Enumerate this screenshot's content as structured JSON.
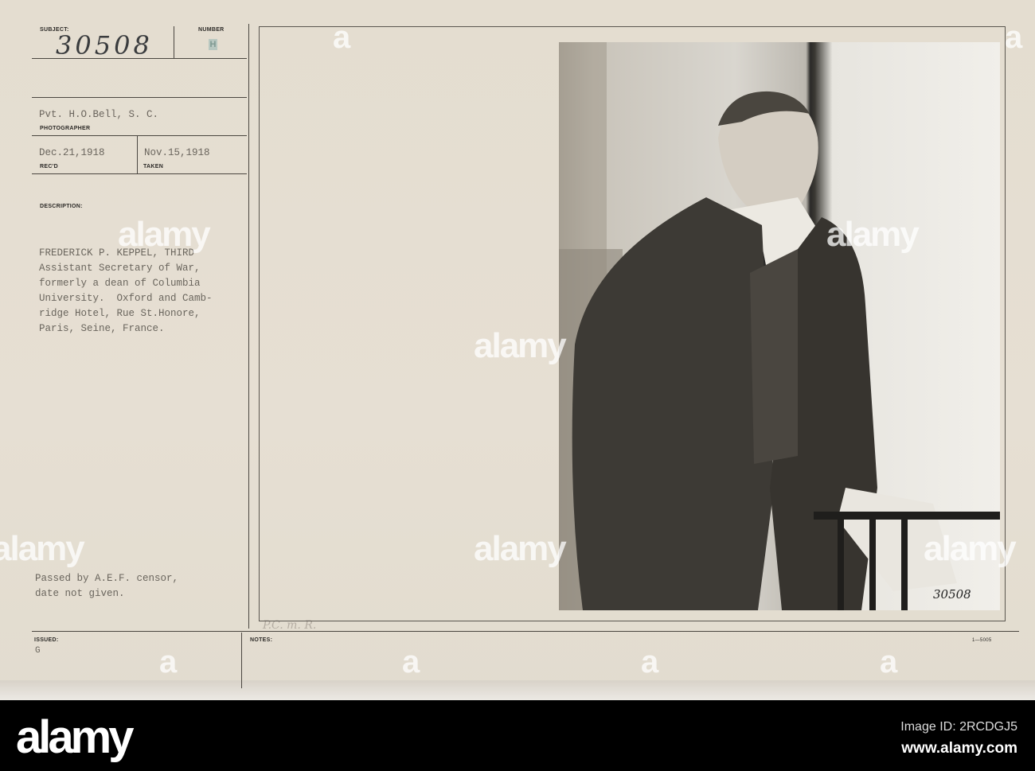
{
  "card": {
    "subject_label": "SUBJECT:",
    "subject_number": "30508",
    "number_label": "NUMBER",
    "number_stamp": "H",
    "photographer": "Pvt. H.O.Bell, S. C.",
    "photographer_label": "PHOTOGRAPHER",
    "received": "Dec.21,1918",
    "received_label": "REC'D",
    "taken": "Nov.15,1918",
    "taken_label": "TAKEN",
    "description_label": "DESCRIPTION:",
    "description_lines": [
      "FREDERICK P. KEPPEL, THIRD",
      "Assistant Secretary of War,",
      "formerly a dean of Columbia",
      "University.  Oxford and Camb-",
      "ridge Hotel, Rue St.Honore,",
      "Paris, Seine, France."
    ],
    "censor_lines": [
      "Passed by A.E.F. censor,",
      "date not given."
    ],
    "issued_label": "ISSUED:",
    "issued_value": "G",
    "notes_label": "NOTES:",
    "notes_handwritten": "P.C. m. R.",
    "form_number": "1—5005",
    "photo_number": "30508"
  },
  "watermark": {
    "text": "alamy",
    "letter": "a",
    "image_id": "Image ID: 2RCDGJ5",
    "url": "www.alamy.com"
  }
}
